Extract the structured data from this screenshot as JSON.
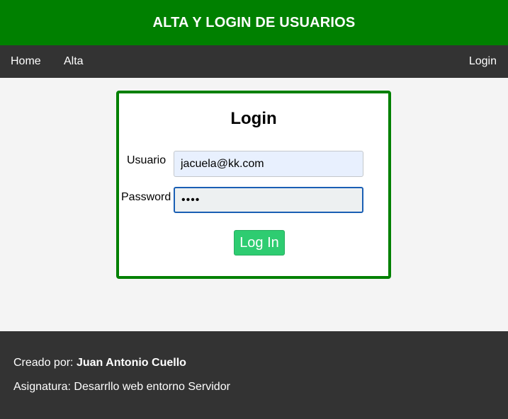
{
  "header": {
    "title": "ALTA Y LOGIN DE USUARIOS"
  },
  "nav": {
    "home": "Home",
    "alta": "Alta",
    "login": "Login"
  },
  "login_form": {
    "title": "Login",
    "username_label": "Usuario",
    "username_value": "jacuela@kk.com",
    "password_label": "Password",
    "password_value": "••••",
    "submit_label": "Log In"
  },
  "footer": {
    "created_by_label": "Creado por:",
    "author": "Juan Antonio Cuello",
    "subject_line": "Asignatura: Desarrllo web entorno Servidor"
  },
  "colors": {
    "header_bg": "#008000",
    "nav_bg": "#333333",
    "button_bg": "#2ecc71",
    "card_border": "#008000"
  }
}
